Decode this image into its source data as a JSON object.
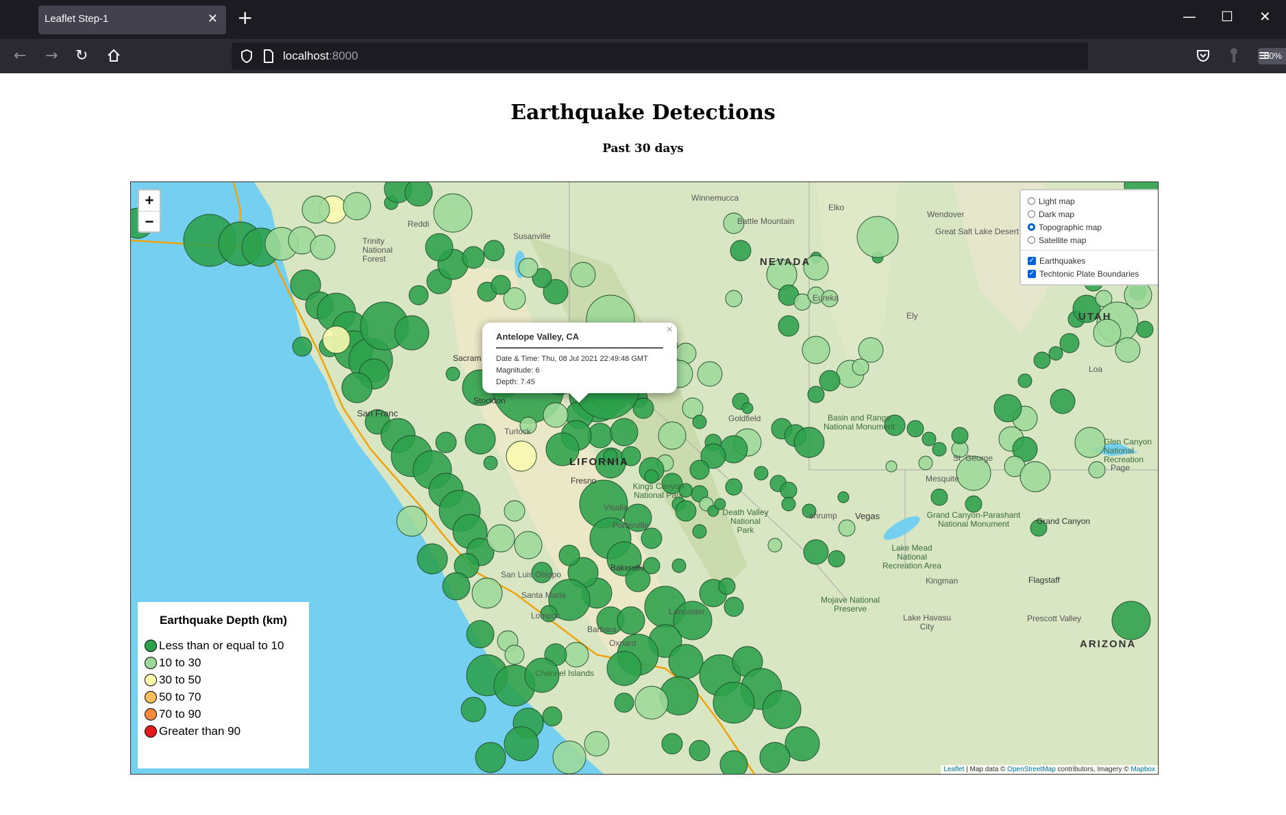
{
  "browser": {
    "tab_title": "Leaflet Step-1",
    "url_host": "localhost",
    "url_port": ":8000",
    "zoom_level": "80%"
  },
  "page": {
    "title": "Earthquake Detections",
    "subtitle": "Past 30 days"
  },
  "map": {
    "zoom_in": "+",
    "zoom_out": "−",
    "layer_control": {
      "base_layers": [
        {
          "label": "Light map",
          "selected": false
        },
        {
          "label": "Dark map",
          "selected": false
        },
        {
          "label": "Topographic map",
          "selected": true
        },
        {
          "label": "Satellite map",
          "selected": false
        }
      ],
      "overlays": [
        {
          "label": "Earthquakes",
          "checked": true
        },
        {
          "label": "Techtonic Plate Boundaries",
          "checked": true
        }
      ]
    },
    "popup": {
      "place": "Antelope Valley, CA",
      "datetime": "Date & Time: Thu, 08 Jul 2021 22:49:48 GMT",
      "magnitude": "Magnitude: 6",
      "depth": "Depth: 7.45",
      "close": "×"
    },
    "legend": {
      "title": "Earthquake Depth (km)",
      "items": [
        {
          "label": "Less than or equal to 10",
          "color": "#2ca14b"
        },
        {
          "label": "10 to 30",
          "color": "#9dd99a"
        },
        {
          "label": "30 to 50",
          "color": "#fbfbb0"
        },
        {
          "label": "50 to 70",
          "color": "#fbc05a"
        },
        {
          "label": "70 to 90",
          "color": "#f88a3b"
        },
        {
          "label": "Greater than 90",
          "color": "#e31a1c"
        }
      ]
    },
    "attribution": {
      "leaflet": "Leaflet",
      "sep": " | Map data © ",
      "osm": "OpenStreetMap",
      "mid": " contributors, Imagery © ",
      "mapbox": "Mapbox"
    },
    "place_labels": {
      "nevada": "NEVADA",
      "utah": "UTAH",
      "california": "LIFORNIA",
      "arizona": "ARIZONA",
      "winnemucca": "Winnemucca",
      "battle_mountain": "Battle Mountain",
      "elko": "Elko",
      "wendover": "Wendover",
      "great_salt_lake_desert": "Great Salt Lake Desert",
      "eureka": "Eureka",
      "ely": "Ely",
      "susanville": "Susanville",
      "redding": "Reddi",
      "trinity_forest": "Trinity National Forest",
      "sacramento": "Sacram",
      "stockton": "Stockton",
      "san_francisco": "San Franc",
      "turlock": "Turlock",
      "fresno": "Fresno",
      "visalia": "Visalia",
      "porterville": "Porterville",
      "kings_canyon": "Kings Canyon National Park",
      "death_valley": "Death Valley National Park",
      "basin_range": "Basin and Range National Monument",
      "goldfield": "Goldfield",
      "st_george": "St. George",
      "mesquite": "Mesquite",
      "page_az": "Page",
      "glen_canyon": "Glen Canyon National Recreation",
      "grand_canyon_parashant": "Grand Canyon-Parashant National Monument",
      "grand_canyon": "Grand Canyon",
      "lake_mead": "Lake Mead National Recreation Area",
      "las_vegas": "Vegas",
      "pahrump": "ahrump",
      "kingman": "Kingman",
      "flagstaff": "Flagstaff",
      "mojave": "Mojave National Preserve",
      "lake_havasu": "Lake Havasu City",
      "prescott_valley": "Prescott Valley",
      "bakersfield": "Bakersfie",
      "san_luis_obispo": "San Luis Obispo",
      "santa_maria": "Santa Maria",
      "lompoc": "Lompoc",
      "lancaster": "Lancaster",
      "oxnard": "Oxnard",
      "santa_barbara": "Barbara",
      "channel_islands": "Channel Islands",
      "loa": "Loa"
    }
  }
}
